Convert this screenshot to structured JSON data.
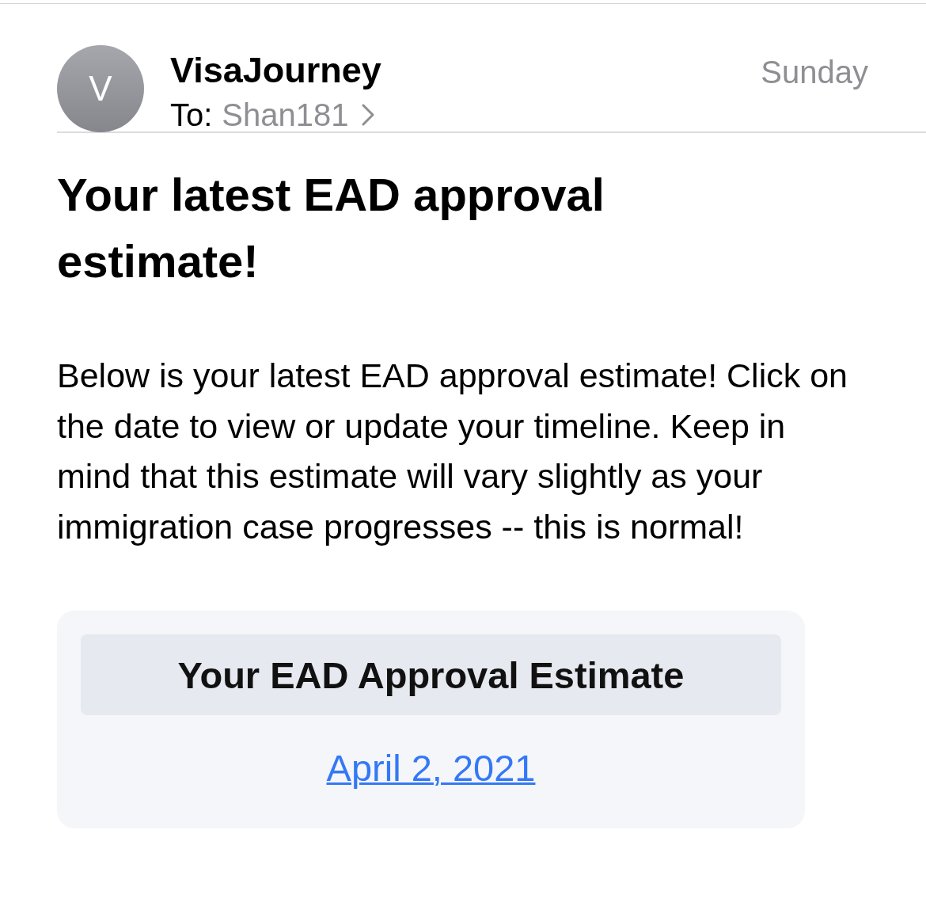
{
  "header": {
    "avatar_letter": "V",
    "sender": "VisaJourney",
    "to_label": "To:",
    "recipient": "Shan181",
    "date": "Sunday"
  },
  "subject": "Your latest EAD approval estimate!",
  "body": "Below is your latest EAD approval estimate! Click on the date to view or update your timeline. Keep in mind that this estimate will vary slightly as your immigration case progresses -- this is normal!",
  "card": {
    "heading": "Your EAD Approval Estimate",
    "link": "April 2, 2021"
  }
}
